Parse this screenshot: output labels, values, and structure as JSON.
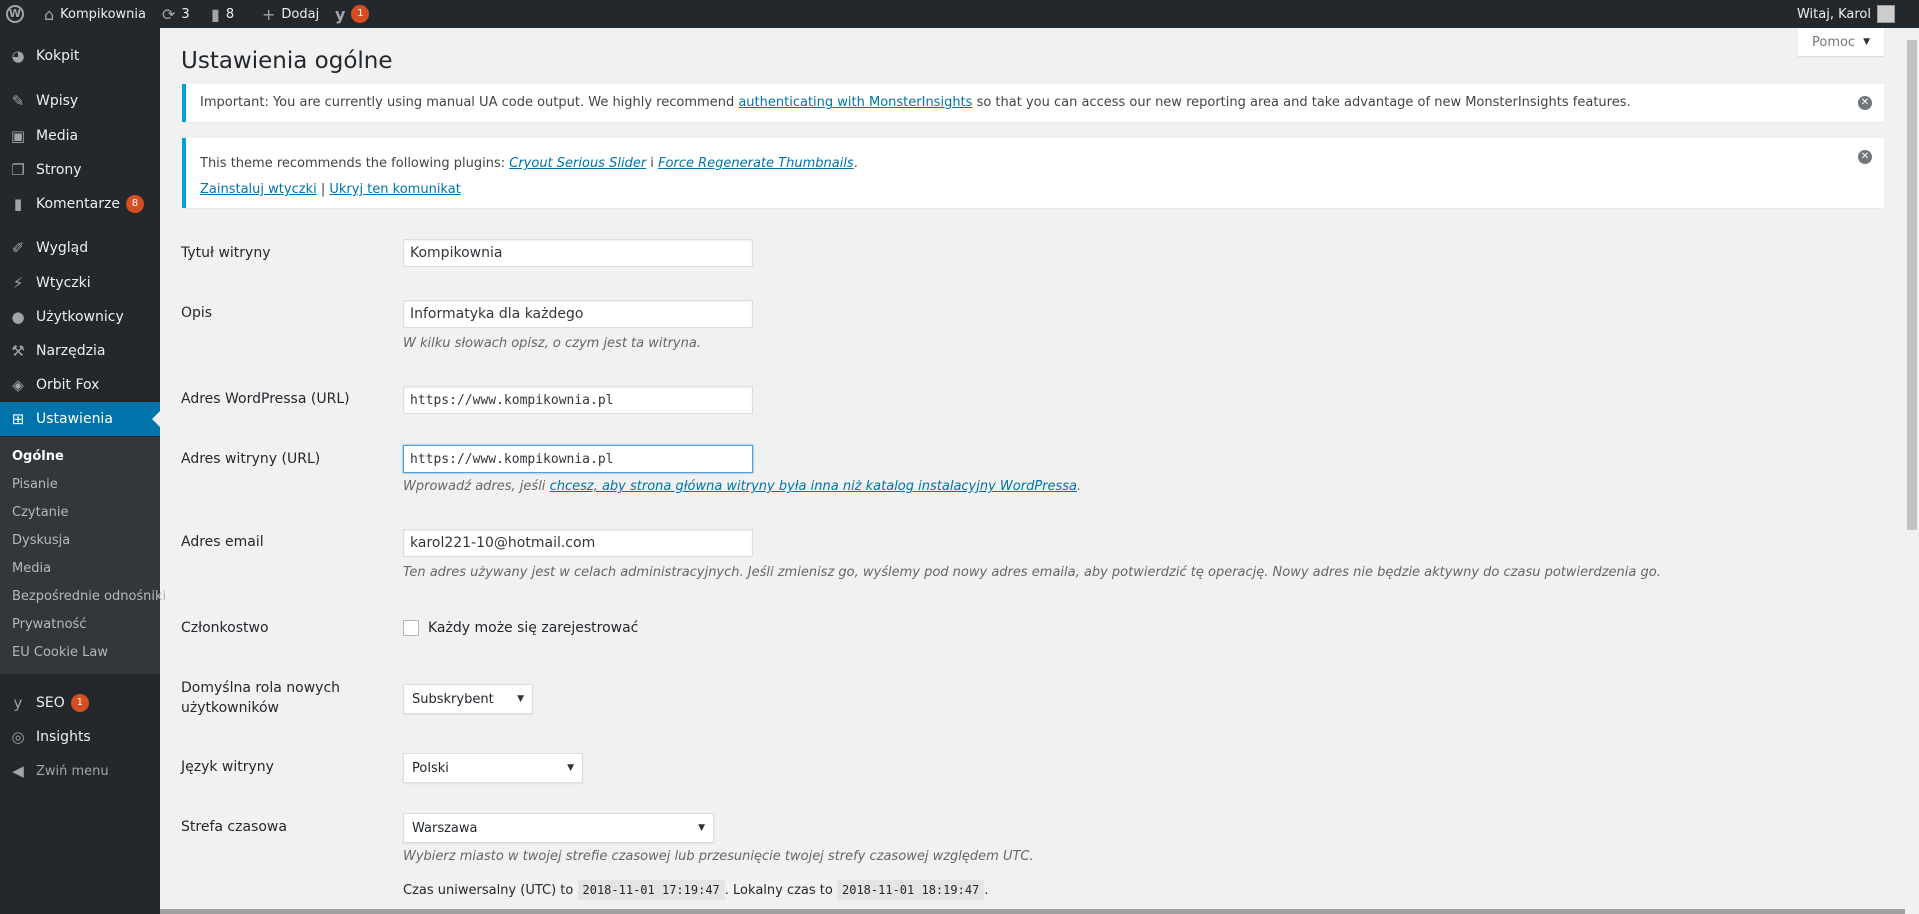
{
  "adminbar": {
    "site": "Kompikownia",
    "updates": "3",
    "comments": "8",
    "add_new": "Dodaj",
    "seo_badge": "1",
    "greeting": "Witaj, Karol"
  },
  "sidebar": {
    "items": [
      {
        "label": "Kokpit",
        "icon": "dashboard-icon"
      },
      {
        "label": "Wpisy",
        "icon": "pin-icon"
      },
      {
        "label": "Media",
        "icon": "media-icon"
      },
      {
        "label": "Strony",
        "icon": "pages-icon"
      },
      {
        "label": "Komentarze",
        "icon": "comment-icon",
        "badge": "8"
      },
      {
        "label": "Wygląd",
        "icon": "brush-icon"
      },
      {
        "label": "Wtyczki",
        "icon": "plugin-icon"
      },
      {
        "label": "Użytkownicy",
        "icon": "user-icon"
      },
      {
        "label": "Narzędzia",
        "icon": "wrench-icon"
      },
      {
        "label": "Orbit Fox",
        "icon": "fox-icon"
      },
      {
        "label": "Ustawienia",
        "icon": "settings-icon",
        "active": true
      },
      {
        "label": "SEO",
        "icon": "yoast-icon",
        "badge": "1"
      },
      {
        "label": "Insights",
        "icon": "insights-icon"
      },
      {
        "label": "Zwiń menu",
        "icon": "collapse-icon"
      }
    ],
    "submenu": [
      "Ogólne",
      "Pisanie",
      "Czytanie",
      "Dyskusja",
      "Media",
      "Bezpośrednie odnośniki",
      "Prywatność",
      "EU Cookie Law"
    ]
  },
  "page": {
    "title": "Ustawienia ogólne",
    "help": "Pomoc"
  },
  "notices": {
    "n1": {
      "before": "Important: You are currently using manual UA code output. We highly recommend ",
      "link": "authenticating with MonsterInsights",
      "after": " so that you can access our new reporting area and take advantage of new MonsterInsights features."
    },
    "n2": {
      "before": "This theme recommends the following plugins: ",
      "link1": "Cryout Serious Slider",
      "mid": " i ",
      "link2": "Force Regenerate Thumbnails",
      "end": ".",
      "install": "Zainstaluj wtyczki",
      "sep": " | ",
      "hide": "Ukryj ten komunikat"
    }
  },
  "form": {
    "site_title": {
      "label": "Tytuł witryny",
      "value": "Kompikownia"
    },
    "tagline": {
      "label": "Opis",
      "value": "Informatyka dla każdego",
      "desc": "W kilku słowach opisz, o czym jest ta witryna."
    },
    "wp_url": {
      "label": "Adres WordPressa (URL)",
      "value": "https://www.kompikownia.pl"
    },
    "site_url": {
      "label": "Adres witryny (URL)",
      "value": "https://www.kompikownia.pl",
      "desc_before": "Wprowadź adres, jeśli ",
      "desc_link": "chcesz, aby strona główna witryny była inna niż katalog instalacyjny WordPressa",
      "desc_after": "."
    },
    "email": {
      "label": "Adres email",
      "value": "karol221-10@hotmail.com",
      "desc": "Ten adres używany jest w celach administracyjnych. Jeśli zmienisz go, wyślemy pod nowy adres emaila, aby potwierdzić tę operację. Nowy adres nie będzie aktywny do czasu potwierdzenia go."
    },
    "membership": {
      "label": "Członkostwo",
      "checkbox": "Każdy może się zarejestrować",
      "checked": false
    },
    "role": {
      "label": "Domyślna rola nowych użytkowników",
      "value": "Subskrybent"
    },
    "language": {
      "label": "Język witryny",
      "value": "Polski"
    },
    "timezone": {
      "label": "Strefa czasowa",
      "value": "Warszawa",
      "desc": "Wybierz miasto w twojej strefie czasowej lub przesunięcie twojej strefy czasowej względem UTC.",
      "utc_label": "Czas uniwersalny (UTC) to",
      "utc": "2018-11-01 17:19:47",
      "local_label": ". Lokalny czas to",
      "local": "2018-11-01 18:19:47",
      "end": "."
    }
  }
}
